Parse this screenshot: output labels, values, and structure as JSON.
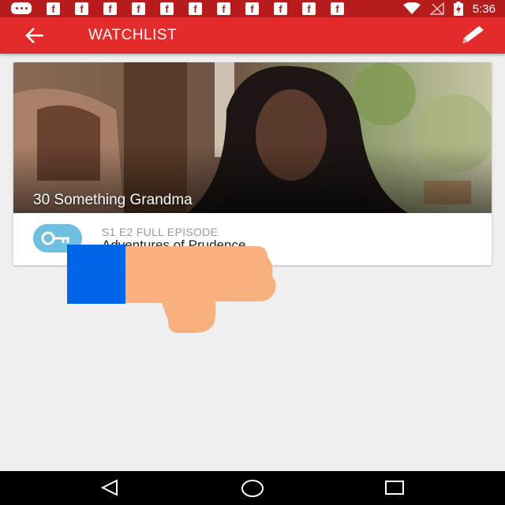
{
  "status_bar": {
    "time": "5:36",
    "notification_icons": [
      "messenger-icon",
      "facebook-icon",
      "facebook-icon",
      "facebook-icon",
      "facebook-icon",
      "facebook-icon",
      "facebook-icon",
      "facebook-icon",
      "facebook-icon",
      "facebook-icon",
      "facebook-icon",
      "facebook-icon"
    ],
    "system_icons": [
      "wifi-icon",
      "no-signal-icon",
      "battery-icon"
    ]
  },
  "app_bar": {
    "title": "WATCHLIST",
    "back_icon": "arrow-left-icon",
    "edit_icon": "pencil-icon",
    "color": "#e32b2b"
  },
  "watchlist": {
    "items": [
      {
        "show_title": "30 Something Grandma",
        "episode_meta": "S1 E2 FULL EPISODE",
        "episode_title": "Adventures of Prudence",
        "badge_icon": "key-icon"
      }
    ]
  },
  "overlay": {
    "icon": "thumbs-down-icon"
  },
  "nav_bar": {
    "icons": [
      "back-triangle-icon",
      "home-circle-icon",
      "recents-square-icon"
    ]
  }
}
